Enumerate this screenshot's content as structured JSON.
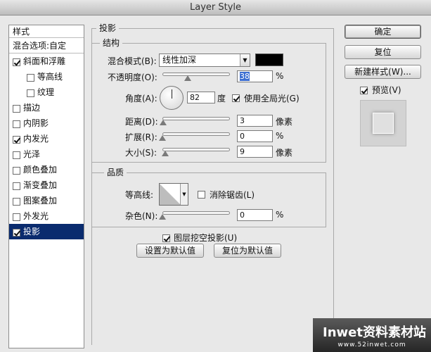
{
  "window": {
    "title": "Layer Style"
  },
  "style_list": {
    "header": "样式",
    "blend_options": "混合选项:自定",
    "items": [
      {
        "label": "斜面和浮雕",
        "checked": true,
        "sub": false,
        "selected": false
      },
      {
        "label": "等高线",
        "checked": false,
        "sub": true,
        "selected": false
      },
      {
        "label": "纹理",
        "checked": false,
        "sub": true,
        "selected": false
      },
      {
        "label": "描边",
        "checked": false,
        "sub": false,
        "selected": false
      },
      {
        "label": "内阴影",
        "checked": false,
        "sub": false,
        "selected": false
      },
      {
        "label": "内发光",
        "checked": true,
        "sub": false,
        "selected": false
      },
      {
        "label": "光泽",
        "checked": false,
        "sub": false,
        "selected": false
      },
      {
        "label": "颜色叠加",
        "checked": false,
        "sub": false,
        "selected": false
      },
      {
        "label": "渐变叠加",
        "checked": false,
        "sub": false,
        "selected": false
      },
      {
        "label": "图案叠加",
        "checked": false,
        "sub": false,
        "selected": false
      },
      {
        "label": "外发光",
        "checked": false,
        "sub": false,
        "selected": false
      },
      {
        "label": "投影",
        "checked": true,
        "sub": false,
        "selected": true
      }
    ]
  },
  "drop_shadow": {
    "title": "投影",
    "structure": {
      "title": "结构",
      "blend_mode_label": "混合模式(B):",
      "blend_mode_value": "线性加深",
      "shadow_color": "#000000",
      "opacity_label": "不透明度(O):",
      "opacity_value": "38",
      "opacity_pct": 38,
      "angle_label": "角度(A):",
      "angle_value": "82",
      "angle_unit": "度",
      "global_light_label": "使用全局光(G)",
      "global_light_checked": true,
      "distance_label": "距离(D):",
      "distance_value": "3",
      "distance_pct": 1,
      "distance_unit": "像素",
      "spread_label": "扩展(R):",
      "spread_value": "0",
      "spread_pct": 0,
      "size_label": "大小(S):",
      "size_value": "9",
      "size_pct": 4,
      "size_unit": "像素",
      "percent": "%"
    },
    "quality": {
      "title": "品质",
      "contour_label": "等高线:",
      "anti_alias_label": "消除锯齿(L)",
      "anti_alias_checked": false,
      "noise_label": "杂色(N):",
      "noise_value": "0",
      "noise_pct": 0,
      "percent": "%"
    },
    "knockout_label": "图层挖空投影(U)",
    "knockout_checked": true,
    "make_default": "设置为默认值",
    "reset_default": "复位为默认值"
  },
  "buttons": {
    "ok": "确定",
    "reset": "复位",
    "new_style": "新建样式(W)...",
    "preview_label": "预览(V)",
    "preview_checked": true
  },
  "watermark": {
    "brand": "Inwet资料素材站",
    "url": "www.52inwet.com"
  }
}
